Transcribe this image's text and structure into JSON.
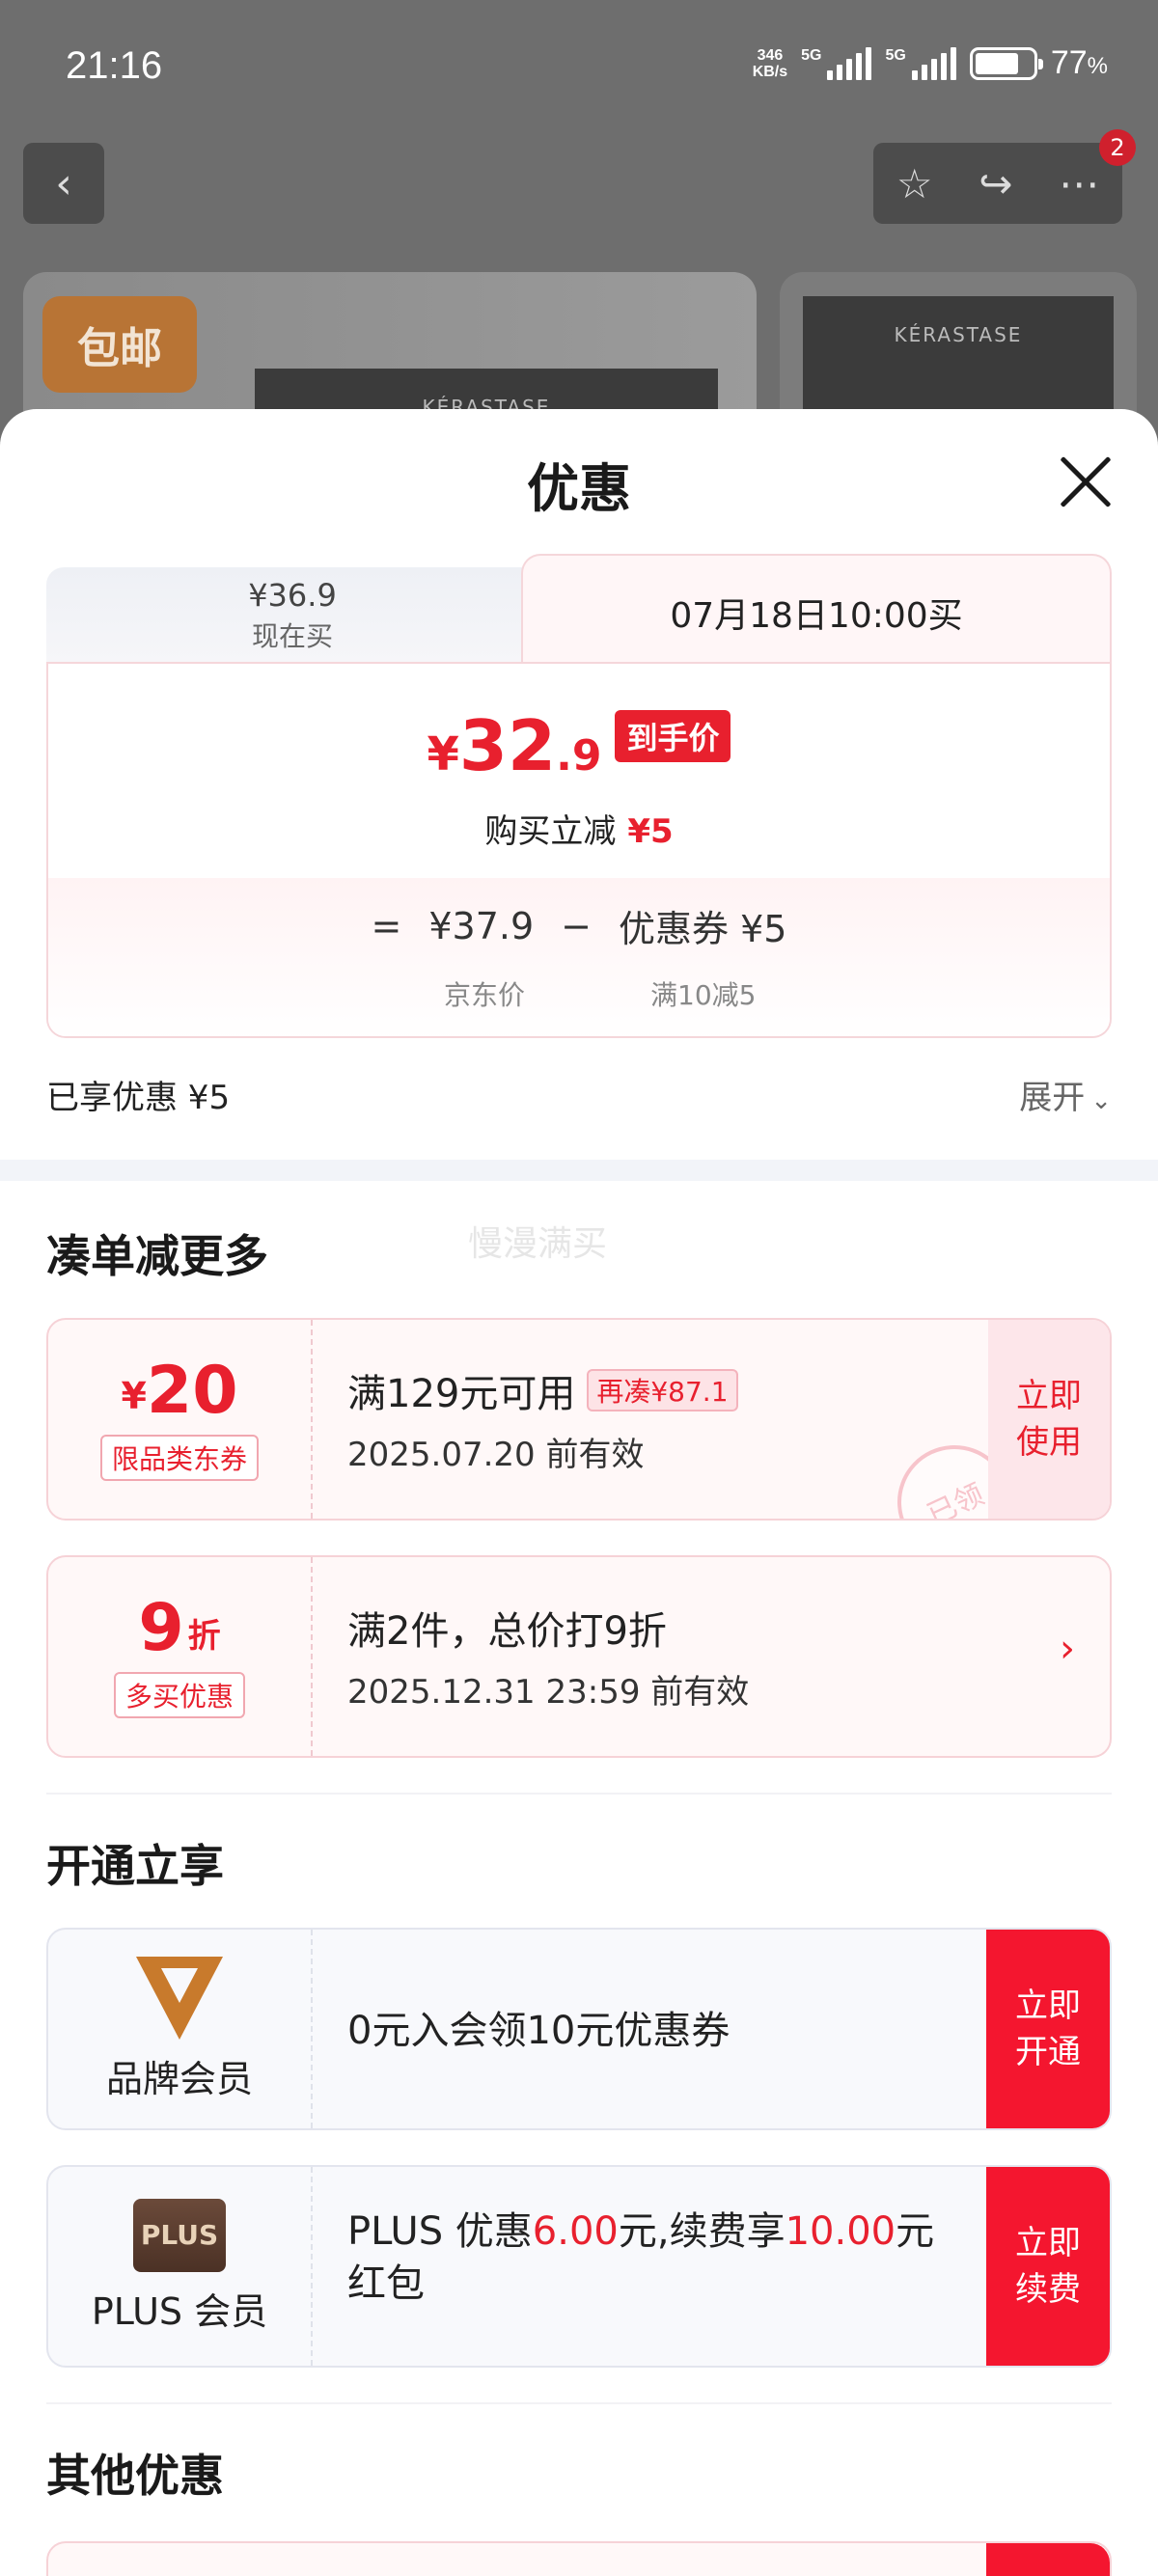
{
  "status_bar": {
    "time": "21:16",
    "net_speed_value": "346",
    "net_speed_unit": "KB/s",
    "network_1": "5G",
    "network_2": "5G",
    "battery": "77",
    "battery_unit": "%"
  },
  "top_nav": {
    "badge_count": "2",
    "badge_label": "包邮",
    "product_brand": "KÉRASTASE",
    "product_brand_2": "KÉRASTASE"
  },
  "sheet": {
    "title": "优惠",
    "tab_now_price": "¥36.9",
    "tab_now_label": "现在买",
    "tab_future_label": "07月18日10:00买",
    "final_price_symbol": "¥",
    "final_price_int": "32",
    "final_price_dec": ".9",
    "final_price_tag": "到手价",
    "instant_discount_label": "购买立减",
    "instant_discount_value": "¥5",
    "formula_eq": "=",
    "formula_price": "¥37.9",
    "formula_minus": "−",
    "formula_coupon": "优惠券 ¥5",
    "formula_price_label": "京东价",
    "formula_coupon_label": "满10减5",
    "enjoyed_label": "已享优惠 ¥5",
    "expand_label": "展开"
  },
  "section_more": {
    "title": "凑单减更多",
    "watermark": "慢漫满买",
    "coupon": {
      "symbol": "¥",
      "amount": "20",
      "type": "限品类东券",
      "condition": "满129元可用",
      "gap": "再凑¥87.1",
      "expiry": "2025.07.20 前有效",
      "action": "立即使用",
      "stamp": "已领"
    },
    "multi": {
      "amount": "9",
      "unit": "折",
      "type": "多买优惠",
      "condition": "满2件，总价打9折",
      "expiry": "2025.12.31 23:59 前有效",
      "chevron": "›"
    }
  },
  "section_open": {
    "title": "开通立享",
    "brand": {
      "label": "品牌会员",
      "desc": "0元入会领10元优惠券",
      "action": "立即开通"
    },
    "plus": {
      "logo": "PLUS",
      "label": "PLUS 会员",
      "desc_1": "PLUS 优惠",
      "value_1": "6.00",
      "desc_2": "元,续费享",
      "value_2": "10.00",
      "desc_3": "元红包",
      "action": "立即续费"
    }
  },
  "section_other": {
    "title": "其他优惠"
  },
  "colors": {
    "accent": "#e8202e",
    "cta": "#f4162f"
  }
}
